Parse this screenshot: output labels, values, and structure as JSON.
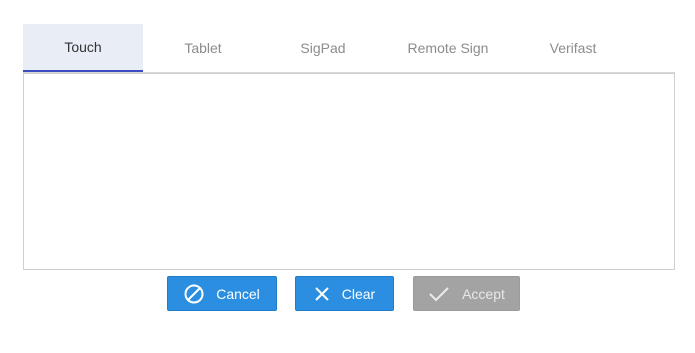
{
  "tabs": [
    {
      "label": "Touch",
      "active": true
    },
    {
      "label": "Tablet",
      "active": false
    },
    {
      "label": "SigPad",
      "active": false
    },
    {
      "label": "Remote Sign",
      "active": false
    },
    {
      "label": "Verifast",
      "active": false
    }
  ],
  "buttons": {
    "cancel": {
      "label": "Cancel",
      "icon": "cancel-circle-icon"
    },
    "clear": {
      "label": "Clear",
      "icon": "x-icon"
    },
    "accept": {
      "label": "Accept",
      "icon": "checkmark-icon",
      "enabled": false
    }
  },
  "colors": {
    "primary": "#2b8ee0",
    "disabled": "#a3a3a3",
    "tab_active_bg": "#e9edf6",
    "tab_active_underline": "#3b4cc0"
  }
}
